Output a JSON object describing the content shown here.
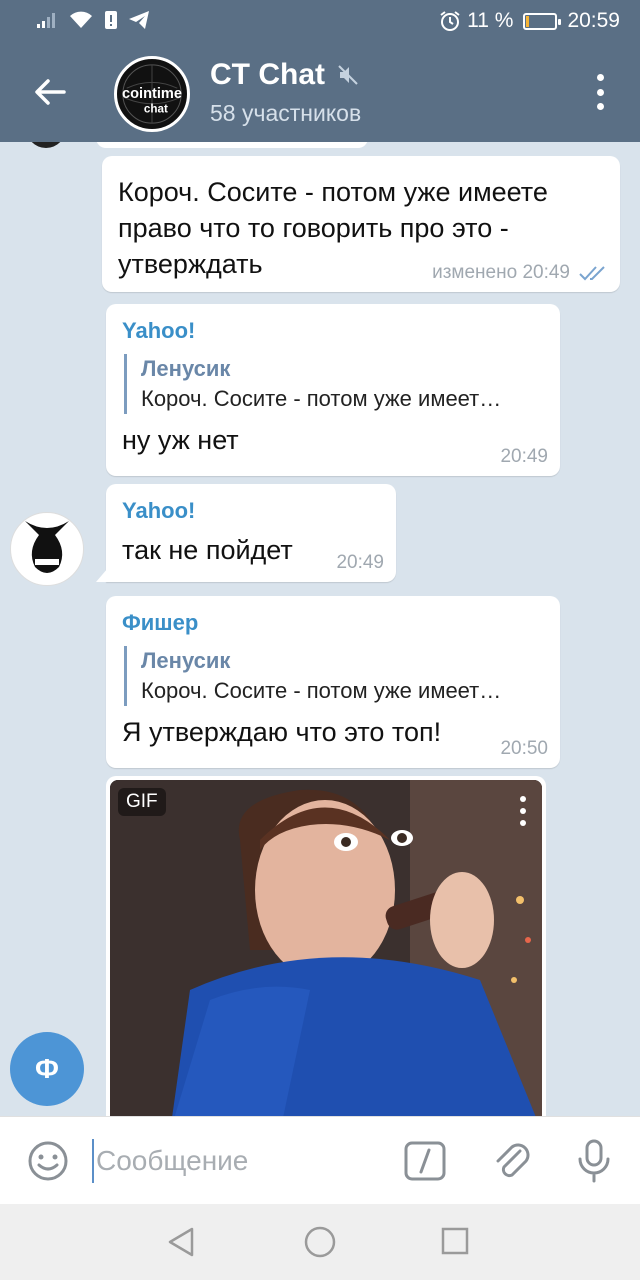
{
  "status_bar": {
    "alarm_icon": "alarm-icon",
    "battery_percent": "11 %",
    "battery_level": 0.11,
    "battery_color": "#f6b436",
    "time": "20:59"
  },
  "header": {
    "title": "CT Chat",
    "subtitle": "58 участников",
    "avatar_text_top": "cointime",
    "avatar_text_bottom": "chat",
    "bg_color": "#5a6f85"
  },
  "messages": [
    {
      "text": "Короч. Сосите - потом уже имеете право что то говорить про это - утверждать",
      "time": "изменено 20:49"
    },
    {
      "sender": "Yahoo!",
      "reply_name": "Ленусик",
      "reply_text": "Короч. Сосите - потом уже имеет…",
      "text": "ну уж нет",
      "time": "20:49"
    },
    {
      "sender": "Yahoo!",
      "text": "так не пойдет",
      "time": "20:49"
    },
    {
      "sender": "Фишер",
      "reply_name": "Ленусик",
      "reply_text": "Короч. Сосите - потом уже имеет…",
      "text": "Я утверждаю что это топ!",
      "time": "20:50"
    }
  ],
  "gif": {
    "badge": "GIF"
  },
  "fisher_avatar_letter": "Ф",
  "input": {
    "placeholder": "Сообщение"
  },
  "accent_color": "#3a8fc8"
}
